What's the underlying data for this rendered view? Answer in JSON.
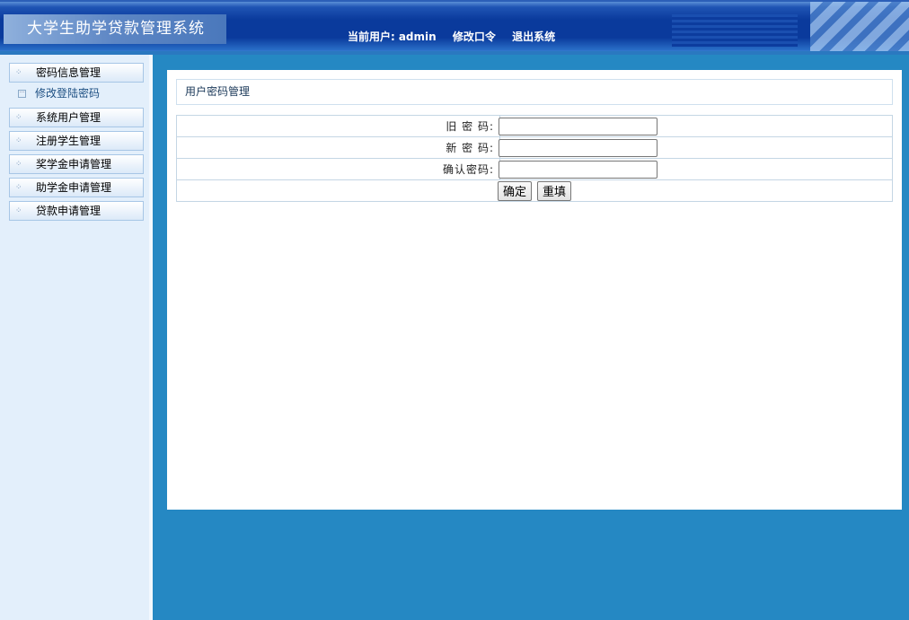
{
  "header": {
    "title": "大学生助学贷款管理系统",
    "current_user_label": "当前用户:",
    "current_user": "admin",
    "change_password": "修改口令",
    "logout": "退出系统"
  },
  "sidebar": {
    "items": [
      {
        "label": "密码信息管理"
      },
      {
        "label": "系统用户管理"
      },
      {
        "label": "注册学生管理"
      },
      {
        "label": "奖学金申请管理"
      },
      {
        "label": "助学金申请管理"
      },
      {
        "label": "贷款申请管理"
      }
    ],
    "sub_item": "修改登陆密码"
  },
  "main": {
    "title": "用户密码管理",
    "fields": [
      {
        "label": "旧 密 码:",
        "value": ""
      },
      {
        "label": "新 密 码:",
        "value": ""
      },
      {
        "label": "确认密码:",
        "value": ""
      }
    ],
    "submit": "确定",
    "reset": "重填"
  }
}
